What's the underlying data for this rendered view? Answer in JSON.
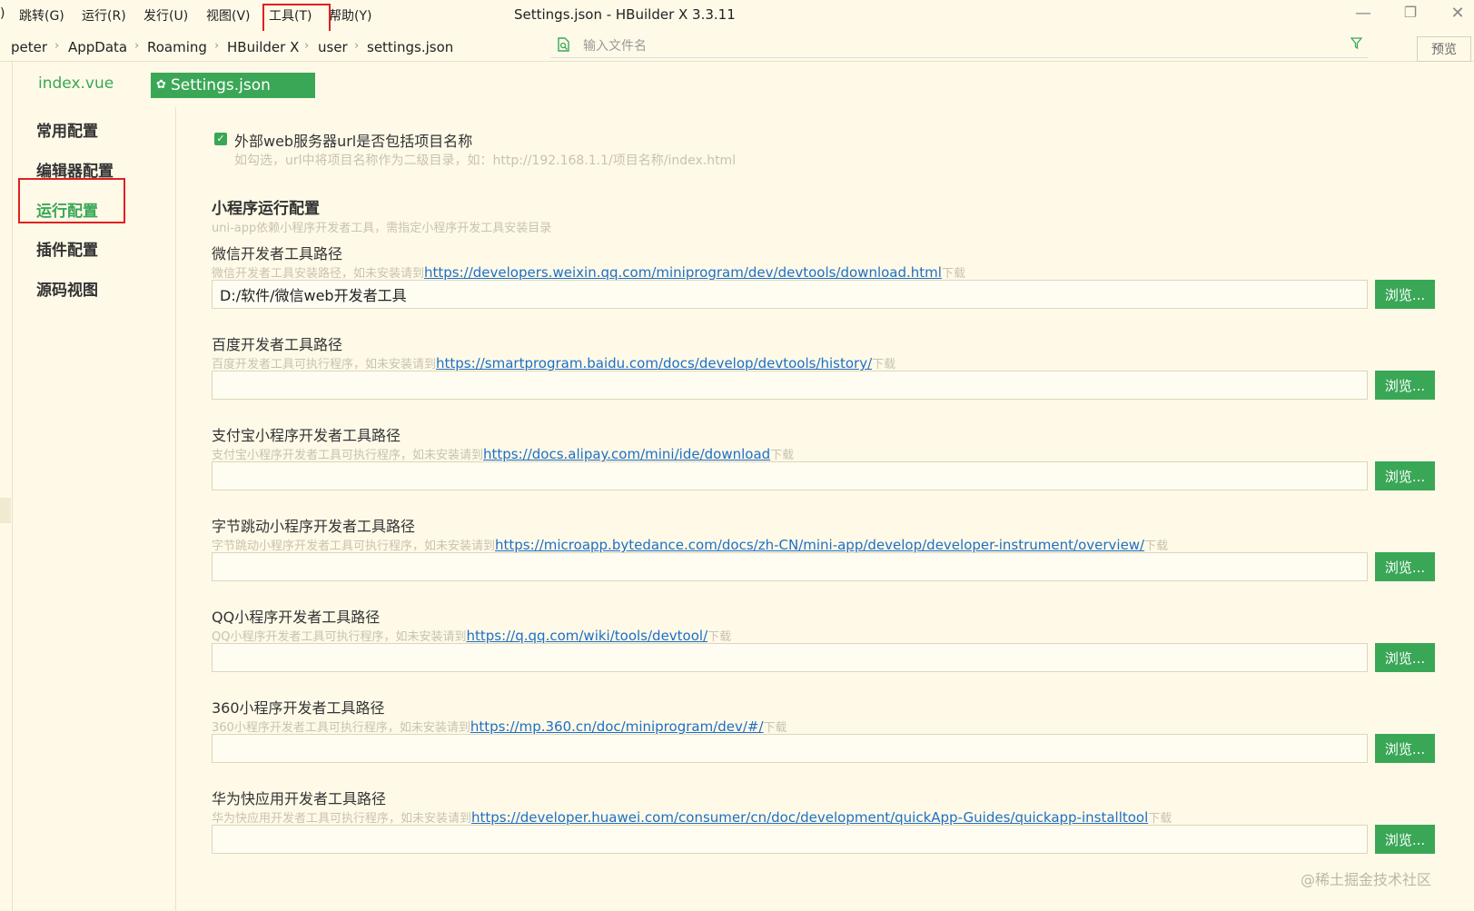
{
  "menu": {
    "items": [
      {
        "label": ")",
        "x": 0
      },
      {
        "label": "跳转(G)"
      },
      {
        "label": "运行(R)"
      },
      {
        "label": "发行(U)"
      },
      {
        "label": "视图(V)"
      },
      {
        "label": "工具(T)"
      },
      {
        "label": "帮助(Y)"
      }
    ]
  },
  "window": {
    "title": "Settings.json - HBuilder X 3.3.11",
    "minimize": "—",
    "restore": "❐",
    "close": "✕"
  },
  "breadcrumb": [
    "peter",
    "AppData",
    "Roaming",
    "HBuilder X",
    "user",
    "settings.json"
  ],
  "breadcrumb_sep": "›",
  "search": {
    "placeholder": "输入文件名",
    "icon": "file-search-icon",
    "filter_icon": "filter-icon"
  },
  "preview_label": "预览",
  "tabs": {
    "index": "index.vue",
    "settings": "Settings.json",
    "gear": "✿"
  },
  "sidebar": {
    "items": [
      "常用配置",
      "编辑器配置",
      "运行配置",
      "插件配置",
      "源码视图"
    ],
    "active": "运行配置"
  },
  "main": {
    "checkbox_label": "外部web服务器url是否包括项目名称",
    "checkbox_checked": true,
    "checkbox_mark": "✓",
    "checkbox_hint": "如勾选，url中将项目名称作为二级目录，如：http://192.168.1.1/项目名称/index.html",
    "section_title": "小程序运行配置",
    "section_hint": "uni-app依赖小程序开发者工具，需指定小程序开发工具安装目录",
    "browse_label": "浏览...",
    "fields": [
      {
        "label": "微信开发者工具路径",
        "hint_prefix": "微信开发者工具安装路径，如未安装请到",
        "link": "https://developers.weixin.qq.com/miniprogram/dev/devtools/download.html",
        "hint_suffix": "下载",
        "value": "D:/软件/微信web开发者工具"
      },
      {
        "label": "百度开发者工具路径",
        "hint_prefix": "百度开发者工具可执行程序，如未安装请到",
        "link": "https://smartprogram.baidu.com/docs/develop/devtools/history/",
        "hint_suffix": "下载",
        "value": ""
      },
      {
        "label": "支付宝小程序开发者工具路径",
        "hint_prefix": "支付宝小程序开发者工具可执行程序，如未安装请到",
        "link": "https://docs.alipay.com/mini/ide/download",
        "hint_suffix": "下载",
        "value": ""
      },
      {
        "label": "字节跳动小程序开发者工具路径",
        "hint_prefix": "字节跳动小程序开发者工具可执行程序，如未安装请到",
        "link": "https://microapp.bytedance.com/docs/zh-CN/mini-app/develop/developer-instrument/overview/",
        "hint_suffix": "下载",
        "value": ""
      },
      {
        "label": "QQ小程序开发者工具路径",
        "hint_prefix": "QQ小程序开发者工具可执行程序，如未安装请到",
        "link": "https://q.qq.com/wiki/tools/devtool/",
        "hint_suffix": "下载",
        "value": ""
      },
      {
        "label": "360小程序开发者工具路径",
        "hint_prefix": "360小程序开发者工具可执行程序，如未安装请到",
        "link": "https://mp.360.cn/doc/miniprogram/dev/#/",
        "hint_suffix": "下载",
        "value": ""
      },
      {
        "label": "华为快应用开发者工具路径",
        "hint_prefix": "华为快应用开发者工具可执行程序，如未安装请到",
        "link": "https://developer.huawei.com/consumer/cn/doc/development/quickApp-Guides/quickapp-installtool",
        "hint_suffix": "下载",
        "value": ""
      }
    ]
  },
  "watermark": "@稀土掘金技术社区",
  "colors": {
    "accent": "#3aa757",
    "background": "#fffae8",
    "link": "#1d6fc6",
    "highlight_box": "#e02020"
  }
}
